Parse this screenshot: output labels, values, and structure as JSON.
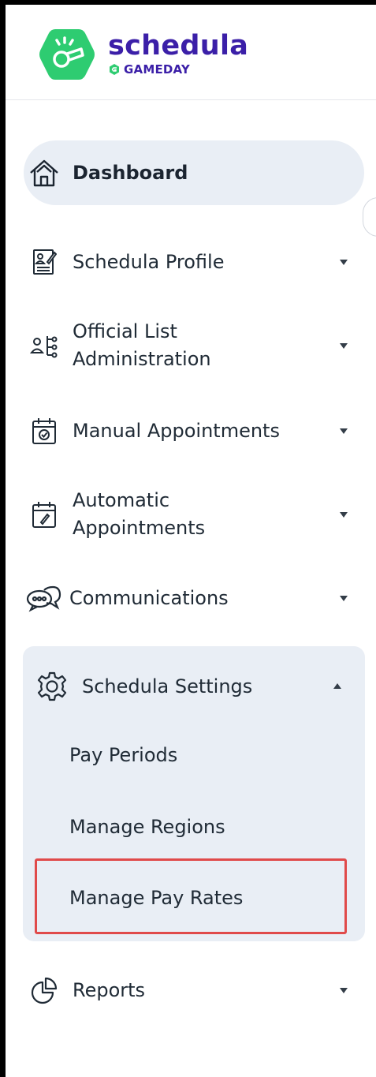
{
  "brand": {
    "name": "schedula",
    "sub": "GAMEDAY",
    "colors": {
      "badge": "#2ecc71",
      "text": "#3b1fa8"
    }
  },
  "nav": {
    "dashboard": {
      "label": "Dashboard",
      "icon": "home-icon"
    },
    "profile": {
      "label": "Schedula Profile",
      "icon": "profile-document-icon"
    },
    "official_list": {
      "label_line1": "Official List",
      "label_line2": "Administration",
      "icon": "official-list-icon"
    },
    "manual": {
      "label": "Manual Appointments",
      "icon": "calendar-check-icon"
    },
    "automatic": {
      "label_line1": "Automatic",
      "label_line2": "Appointments",
      "icon": "calendar-edit-icon"
    },
    "communications": {
      "label": "Communications",
      "icon": "chat-bubbles-icon"
    },
    "settings": {
      "label": "Schedula Settings",
      "icon": "gear-icon",
      "expanded": true,
      "children": [
        "Pay Periods",
        "Manage Regions",
        "Manage Pay Rates"
      ],
      "highlighted": "Manage Pay Rates"
    },
    "reports": {
      "label": "Reports",
      "icon": "pie-chart-icon"
    }
  },
  "colors": {
    "active_bg": "#e9eef5",
    "highlight": "#e04a4a"
  }
}
